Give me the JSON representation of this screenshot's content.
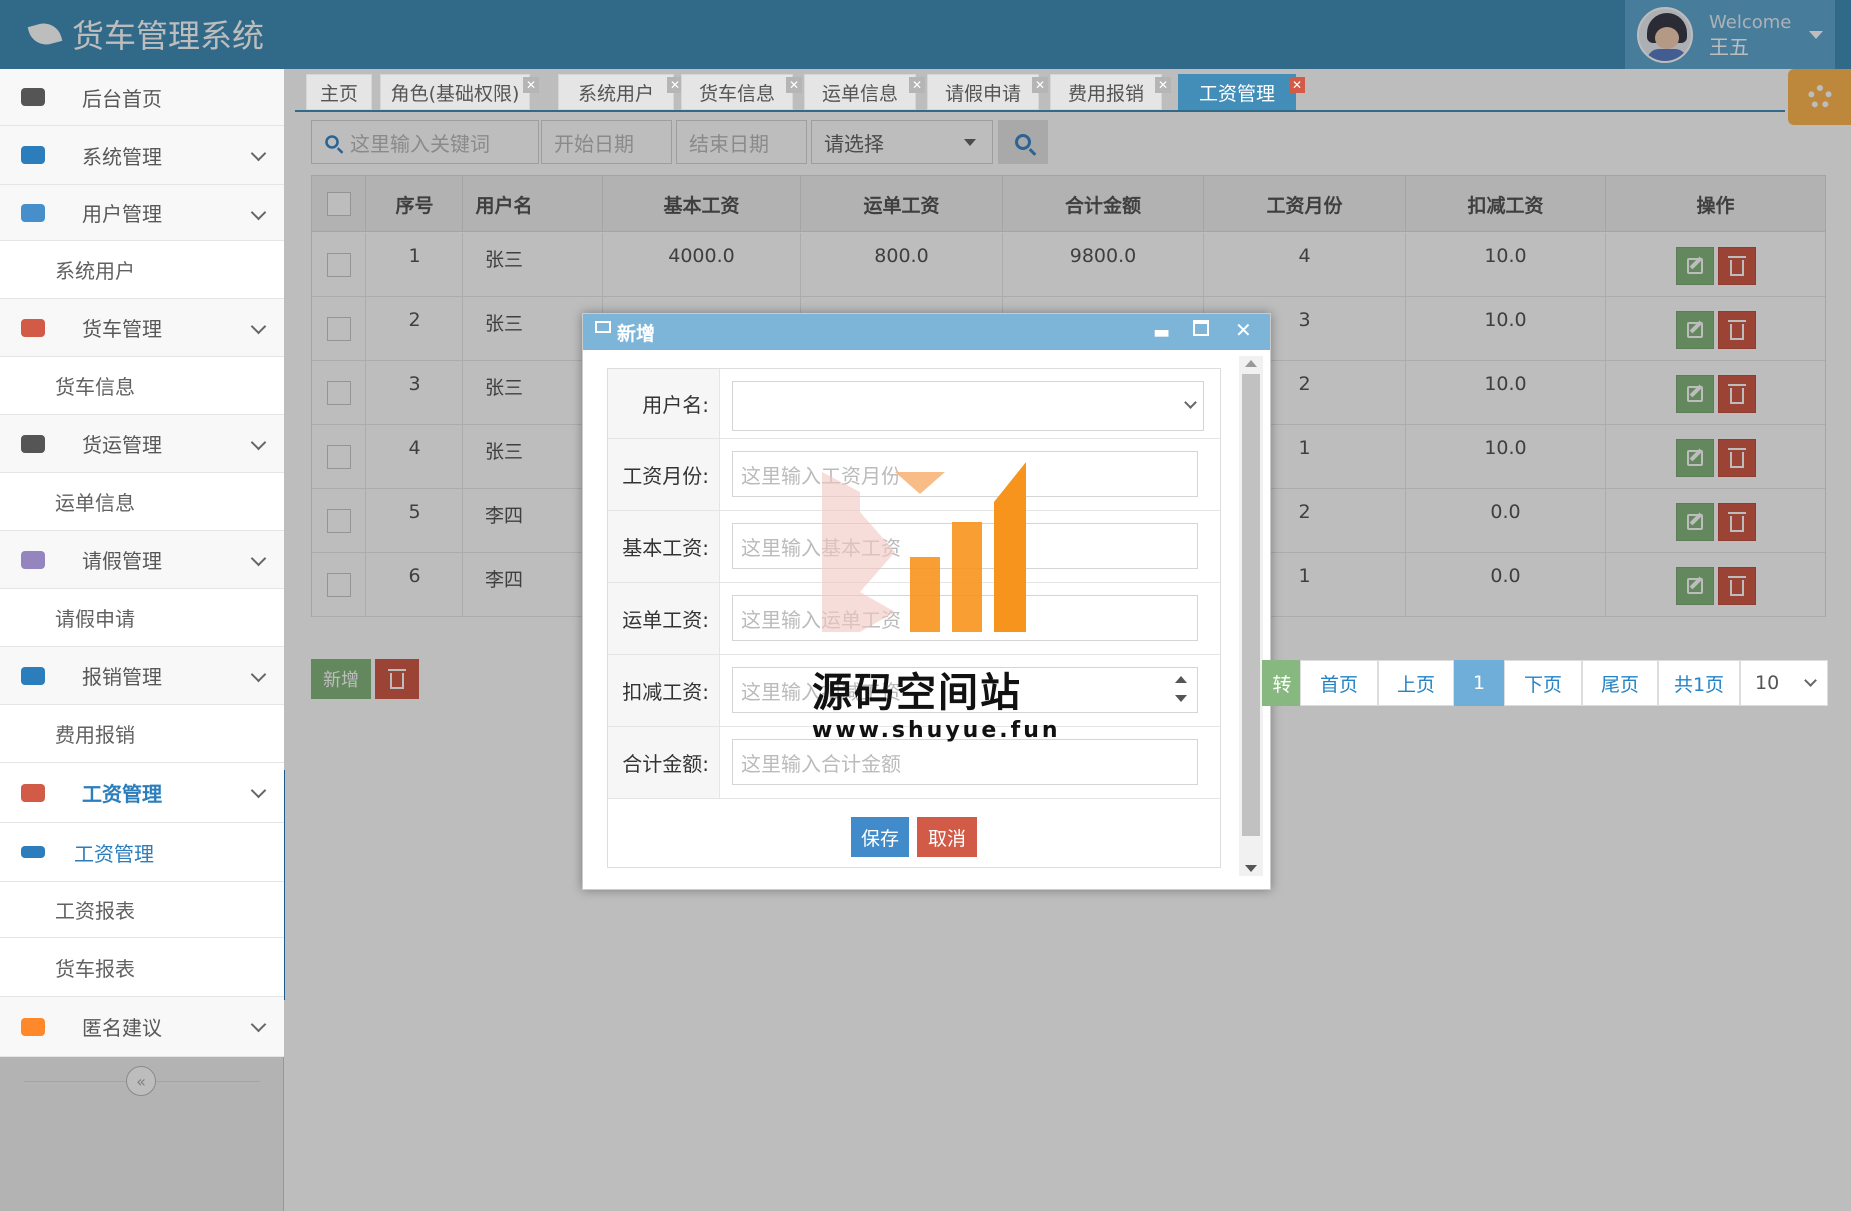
{
  "app": {
    "title": "货车管理系统"
  },
  "user": {
    "welcome": "Welcome",
    "name": "王五"
  },
  "sidebar": {
    "items": [
      {
        "label": "后台首页",
        "type": "top",
        "icon": "dashboard-icon"
      },
      {
        "label": "系统管理",
        "type": "top",
        "icon": "home-icon"
      },
      {
        "label": "用户管理",
        "type": "top",
        "icon": "users-icon"
      },
      {
        "label": "系统用户",
        "type": "sub"
      },
      {
        "label": "货车管理",
        "type": "top",
        "icon": "bullhorn-icon"
      },
      {
        "label": "货车信息",
        "type": "sub"
      },
      {
        "label": "货运管理",
        "type": "top",
        "icon": "leaf-icon"
      },
      {
        "label": "运单信息",
        "type": "sub"
      },
      {
        "label": "请假管理",
        "type": "top",
        "icon": "exchange-icon"
      },
      {
        "label": "请假申请",
        "type": "sub"
      },
      {
        "label": "报销管理",
        "type": "top",
        "icon": "flag-icon"
      },
      {
        "label": "费用报销",
        "type": "sub"
      },
      {
        "label": "工资管理",
        "type": "top",
        "icon": "credit-card-icon",
        "active": true
      },
      {
        "label": "工资管理",
        "type": "sub",
        "icon": "card-icon",
        "active": true
      },
      {
        "label": "工资报表",
        "type": "sub"
      },
      {
        "label": "货车报表",
        "type": "sub"
      },
      {
        "label": "匿名建议",
        "type": "top",
        "icon": "comment-icon"
      }
    ]
  },
  "tabs": [
    {
      "label": "主页"
    },
    {
      "label": "角色(基础权限)"
    },
    {
      "label": "系统用户"
    },
    {
      "label": "货车信息"
    },
    {
      "label": "运单信息"
    },
    {
      "label": "请假申请"
    },
    {
      "label": "费用报销"
    },
    {
      "label": "工资管理",
      "active": true
    }
  ],
  "toolbar": {
    "keyword_placeholder": "这里输入关键词",
    "start_date_placeholder": "开始日期",
    "end_date_placeholder": "结束日期",
    "select_value": "请选择"
  },
  "table": {
    "columns": [
      "序号",
      "用户名",
      "基本工资",
      "运单工资",
      "合计金额",
      "工资月份",
      "扣减工资",
      "操作"
    ],
    "rows": [
      [
        "1",
        "张三",
        "4000.0",
        "800.0",
        "9800.0",
        "4",
        "10.0"
      ],
      [
        "2",
        "张三",
        "",
        "",
        "",
        "3",
        "10.0"
      ],
      [
        "3",
        "张三",
        "",
        "",
        "",
        "2",
        "10.0"
      ],
      [
        "4",
        "张三",
        "",
        "",
        "",
        "1",
        "10.0"
      ],
      [
        "5",
        "李四",
        "",
        "",
        "",
        "2",
        "0.0"
      ],
      [
        "6",
        "李四",
        "",
        "",
        "",
        "1",
        "0.0"
      ]
    ]
  },
  "actions": {
    "add_label": "新增"
  },
  "pager": {
    "partial": "转",
    "first": "首页",
    "prev": "上页",
    "current": "1",
    "next": "下页",
    "last": "尾页",
    "total": "共1页",
    "page_size": "10"
  },
  "dialog": {
    "title": "新增",
    "fields": [
      {
        "label": "用户名:",
        "placeholder": "",
        "kind": "select"
      },
      {
        "label": "工资月份:",
        "placeholder": "这里输入工资月份",
        "kind": "text"
      },
      {
        "label": "基本工资:",
        "placeholder": "这里输入基本工资",
        "kind": "text"
      },
      {
        "label": "运单工资:",
        "placeholder": "这里输入运单工资",
        "kind": "text"
      },
      {
        "label": "扣减工资:",
        "placeholder": "这里输入扣减工资",
        "kind": "number"
      },
      {
        "label": "合计金额:",
        "placeholder": "这里输入合计金额",
        "kind": "text"
      }
    ],
    "save_label": "保存",
    "cancel_label": "取消"
  },
  "watermark": {
    "text": "源码空间站",
    "url": "www.shuyue.fun"
  },
  "colors": {
    "header": "#438eb9",
    "green": "#87b87f",
    "red": "#d15b47",
    "accent": "#2b7dbc",
    "orange": "#f7941d"
  }
}
